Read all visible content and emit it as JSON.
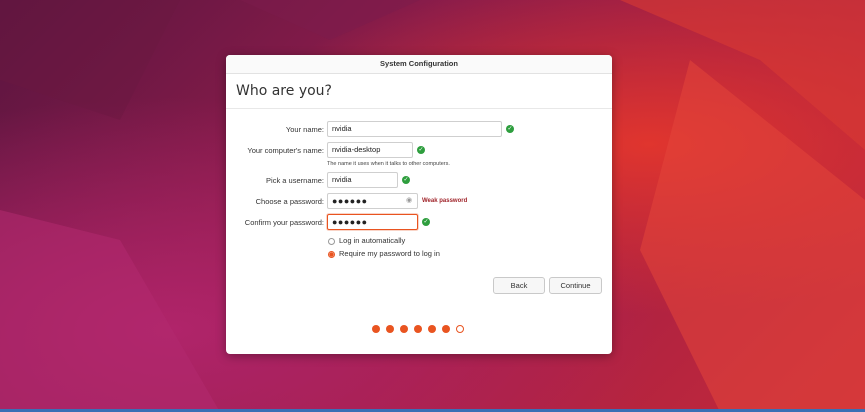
{
  "window": {
    "title": "System Configuration"
  },
  "page": {
    "heading": "Who are you?"
  },
  "form": {
    "name_label": "Your name:",
    "name_value": "nvidia",
    "computer_label": "Your computer's name:",
    "computer_value": "nvidia-desktop",
    "computer_hint": "The name it uses when it talks to other computers.",
    "username_label": "Pick a username:",
    "username_value": "nvidia",
    "password_label": "Choose a password:",
    "password_value": "●●●●●●",
    "password_strength": "Weak password",
    "confirm_label": "Confirm your password:",
    "confirm_value": "●●●●●●"
  },
  "login_options": [
    {
      "label": "Log in automatically",
      "selected": false
    },
    {
      "label": "Require my password to log in",
      "selected": true
    }
  ],
  "buttons": {
    "back": "Back",
    "continue": "Continue"
  },
  "progress": {
    "completed_steps": 6,
    "total_steps": 7
  },
  "colors": {
    "accent": "#e95420",
    "valid": "#2e9e3e",
    "weak": "#a0242a"
  },
  "icons": {
    "check": "check-icon",
    "reveal": "eye-icon"
  }
}
